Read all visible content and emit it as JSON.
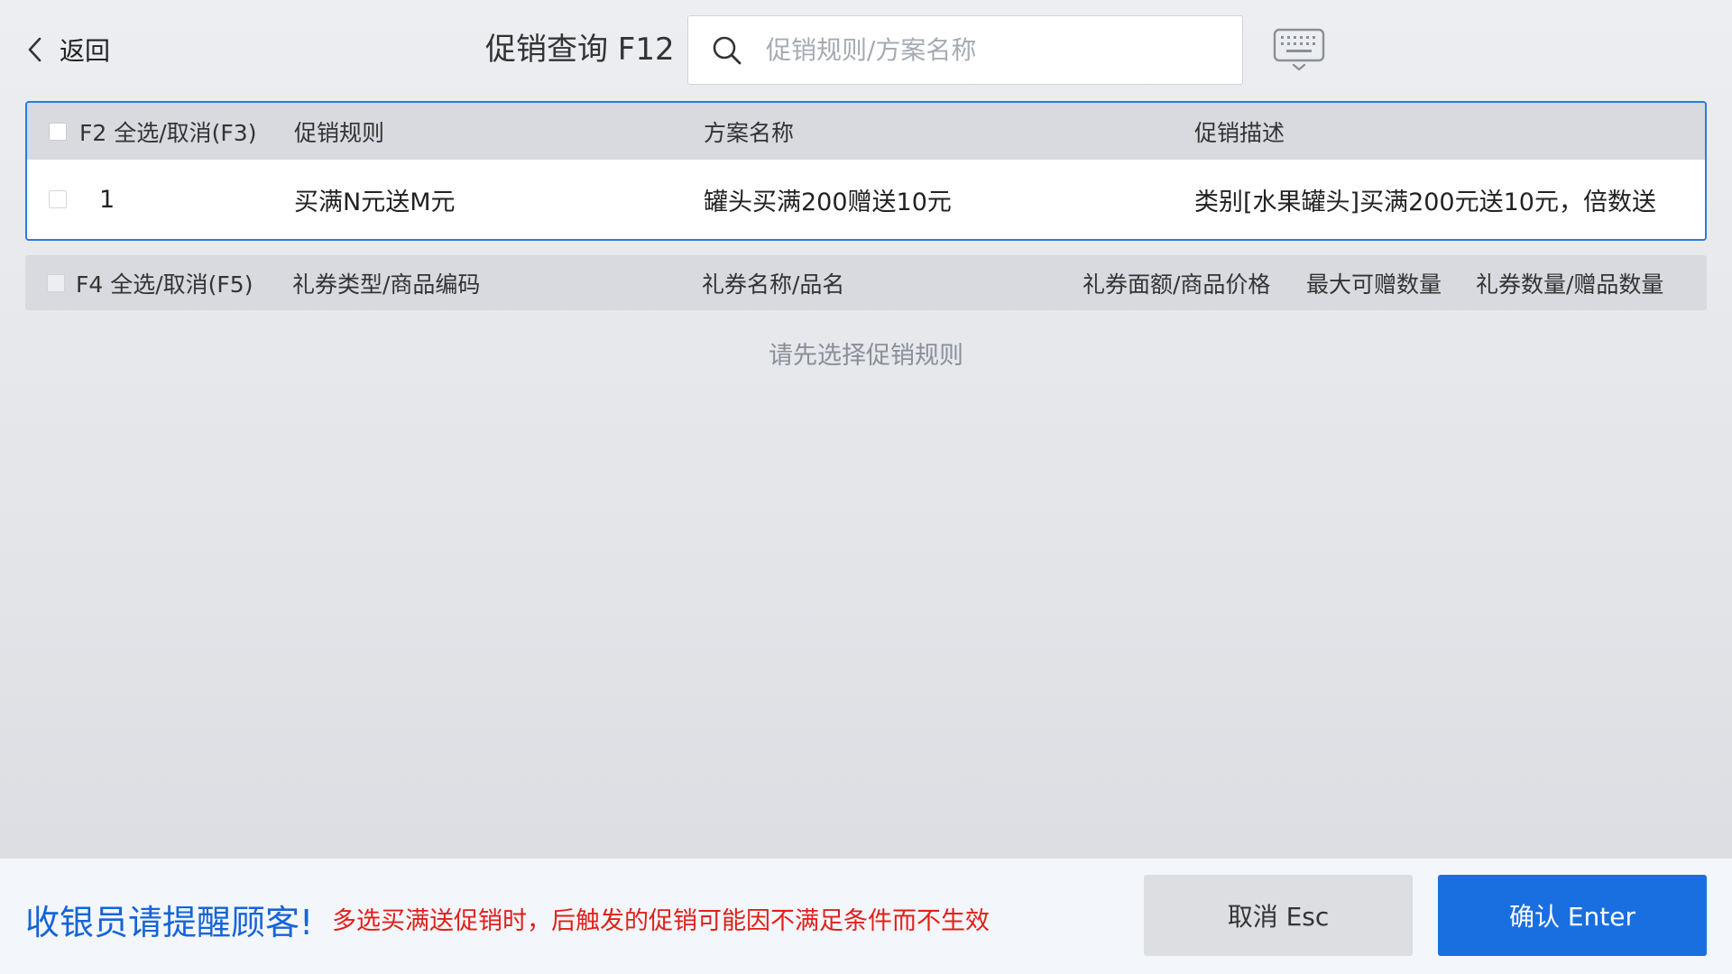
{
  "header": {
    "back_label": "返回",
    "title": "促销查询 F12",
    "search_placeholder": "促销规则/方案名称",
    "search_value": ""
  },
  "rules_table": {
    "select_all_label": "F2 全选/取消(F3)",
    "columns": [
      "促销规则",
      "方案名称",
      "促销描述"
    ],
    "rows": [
      {
        "index": "1",
        "rule": "买满N元送M元",
        "scheme": "罐头买满200赠送10元",
        "description": "类别[水果罐头]买满200元送10元，倍数送",
        "checked": false
      }
    ]
  },
  "gifts_table": {
    "select_all_label": "F4 全选/取消(F5)",
    "columns": [
      "礼券类型/商品编码",
      "礼券名称/品名",
      "礼券面额/商品价格",
      "最大可赠数量",
      "礼券数量/赠品数量"
    ],
    "empty_hint": "请先选择促销规则"
  },
  "footer": {
    "warn_title": "收银员请提醒顾客!",
    "warn_text": "多选买满送促销时，后触发的促销可能因不满足条件而不生效",
    "cancel_label": "取消 Esc",
    "confirm_label": "确认 Enter"
  },
  "colors": {
    "accent": "#1a6fe0",
    "warning_title": "#1565d8",
    "warning_text": "#e0201a",
    "selected_border": "#2a7ae2"
  }
}
